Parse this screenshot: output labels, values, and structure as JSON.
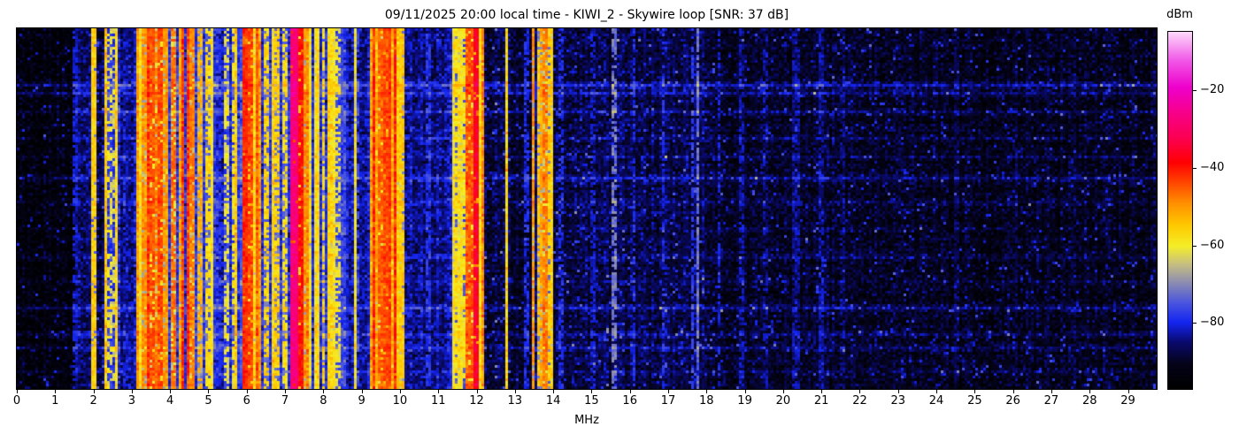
{
  "title": "09/11/2025 20:00 local time - KIWI_2 - Skywire loop [SNR: 37 dB]",
  "station": {
    "date": "09/11/2025",
    "time": "20:00 local time",
    "receiver": "KIWI_2",
    "antenna": "Skywire loop",
    "snr": "37 dB"
  },
  "colors": {
    "background": "#ffffff",
    "text": "#000000",
    "axes": "#000000"
  },
  "chart_data": {
    "type": "heatmap",
    "subtype": "radio-spectrum-waterfall",
    "title": "09/11/2025 20:00 local time - KIWI_2 - Skywire loop [SNR: 37 dB]",
    "xlabel": "MHz",
    "x_range": [
      0,
      29.75
    ],
    "x_ticks": [
      0,
      1,
      2,
      3,
      4,
      5,
      6,
      7,
      8,
      9,
      10,
      11,
      12,
      13,
      14,
      15,
      16,
      17,
      18,
      19,
      20,
      21,
      22,
      23,
      24,
      25,
      26,
      27,
      28,
      29
    ],
    "y_axis": {
      "meaning": "time (rows, no tick labels shown)",
      "ticks": []
    },
    "grid": false,
    "colorbar": {
      "label": "dBm",
      "vmin": -97,
      "vmax": -5,
      "ticks": [
        {
          "value": -20,
          "label": "−20"
        },
        {
          "value": -40,
          "label": "−40"
        },
        {
          "value": -60,
          "label": "−60"
        },
        {
          "value": -80,
          "label": "−80"
        }
      ]
    },
    "colormap_stops": [
      [
        0.0,
        "#000000"
      ],
      [
        0.07,
        "#05041a"
      ],
      [
        0.13,
        "#0a0a6e"
      ],
      [
        0.185,
        "#1425f0"
      ],
      [
        0.24,
        "#4a55e0"
      ],
      [
        0.3,
        "#9090b0"
      ],
      [
        0.35,
        "#c8c080"
      ],
      [
        0.4,
        "#f5ef28"
      ],
      [
        0.46,
        "#ffc800"
      ],
      [
        0.52,
        "#ff9000"
      ],
      [
        0.58,
        "#ff4400"
      ],
      [
        0.635,
        "#ff0004"
      ],
      [
        0.7,
        "#fc0050"
      ],
      [
        0.78,
        "#f70090"
      ],
      [
        0.845,
        "#ee00cc"
      ],
      [
        0.92,
        "#f158e8"
      ],
      [
        1.0,
        "#fed9fb"
      ]
    ],
    "noise_floor_segments": [
      [
        0.0,
        1.5,
        -94,
        0,
        0,
        0
      ],
      [
        1.5,
        1.95,
        -85,
        0.02,
        0,
        0
      ],
      [
        1.95,
        2.3,
        -88,
        0,
        0,
        0
      ],
      [
        2.3,
        2.7,
        -82,
        0.18,
        0.03,
        0
      ],
      [
        2.7,
        3.1,
        -84,
        0.08,
        0,
        0
      ],
      [
        3.1,
        5.1,
        -78,
        0.3,
        0.16,
        0.1
      ],
      [
        5.1,
        5.8,
        -80,
        0.22,
        0.06,
        0.02
      ],
      [
        5.8,
        6.25,
        -76,
        0.25,
        0.2,
        0.18
      ],
      [
        6.25,
        7.1,
        -78,
        0.28,
        0.12,
        0.06
      ],
      [
        7.1,
        7.45,
        -74,
        0.2,
        0.2,
        0.2
      ],
      [
        7.45,
        8.55,
        -78,
        0.3,
        0.1,
        0.03
      ],
      [
        8.55,
        9.2,
        -83,
        0.1,
        0.02,
        0
      ],
      [
        9.2,
        10.05,
        -72,
        0.3,
        0.3,
        0.12
      ],
      [
        10.05,
        11.3,
        -84,
        0.04,
        0.01,
        0
      ],
      [
        11.3,
        12.15,
        -80,
        0.22,
        0.08,
        0.05
      ],
      [
        12.15,
        13.4,
        -89,
        0.02,
        0,
        0
      ],
      [
        13.4,
        14.0,
        -84,
        0.12,
        0.04,
        0.04
      ],
      [
        14.0,
        18.0,
        -88,
        0.01,
        0,
        0
      ],
      [
        18.0,
        22.0,
        -90,
        0,
        0,
        0
      ],
      [
        22.0,
        29.75,
        -91,
        0,
        0,
        0
      ]
    ],
    "signal_lines": [
      [
        1.5,
        -82,
        0.05,
        0.3
      ],
      [
        2.0,
        -56,
        0.06,
        0.05
      ],
      [
        2.42,
        -62,
        0.05,
        0.5
      ],
      [
        2.55,
        -64,
        0.05,
        0.5
      ],
      [
        3.33,
        -50,
        0.06,
        0.2
      ],
      [
        3.5,
        -45,
        0.08,
        0.15
      ],
      [
        3.62,
        -48,
        0.06,
        0.2
      ],
      [
        3.75,
        -44,
        0.07,
        0.15
      ],
      [
        3.88,
        -50,
        0.06,
        0.2
      ],
      [
        4.05,
        -47,
        0.07,
        0.2
      ],
      [
        4.3,
        -52,
        0.06,
        0.25
      ],
      [
        4.55,
        -48,
        0.06,
        0.2
      ],
      [
        4.8,
        -53,
        0.06,
        0.25
      ],
      [
        5.0,
        -58,
        0.05,
        0.3
      ],
      [
        5.45,
        -62,
        0.05,
        0.4
      ],
      [
        5.65,
        -60,
        0.05,
        0.35
      ],
      [
        5.95,
        -42,
        0.1,
        0.1
      ],
      [
        6.07,
        -44,
        0.06,
        0.12
      ],
      [
        6.5,
        -57,
        0.05,
        0.3
      ],
      [
        6.8,
        -56,
        0.05,
        0.3
      ],
      [
        7.0,
        -58,
        0.05,
        0.3
      ],
      [
        7.25,
        -28,
        0.16,
        0.02
      ],
      [
        7.38,
        -40,
        0.05,
        0.1
      ],
      [
        7.45,
        -50,
        0.05,
        0.2
      ],
      [
        7.8,
        -59,
        0.05,
        0.35
      ],
      [
        8.0,
        -57,
        0.05,
        0.3
      ],
      [
        8.35,
        -61,
        0.05,
        0.4
      ],
      [
        8.9,
        -77,
        0.05,
        0.4
      ],
      [
        9.35,
        -52,
        0.06,
        0.15
      ],
      [
        9.5,
        -46,
        0.06,
        0.1
      ],
      [
        9.6,
        -44,
        0.06,
        0.1
      ],
      [
        9.72,
        -44,
        0.06,
        0.1
      ],
      [
        9.85,
        -52,
        0.06,
        0.15
      ],
      [
        10.0,
        -55,
        0.08,
        0.15
      ],
      [
        10.7,
        -79,
        0.05,
        0.4
      ],
      [
        11.45,
        -58,
        0.05,
        0.25
      ],
      [
        11.62,
        -60,
        0.05,
        0.3
      ],
      [
        11.85,
        -45,
        0.06,
        0.12
      ],
      [
        11.97,
        -35,
        0.06,
        0.05
      ],
      [
        12.1,
        -70,
        0.04,
        0.3
      ],
      [
        13.3,
        -80,
        0.04,
        0.4
      ],
      [
        13.46,
        -50,
        0.05,
        0.2
      ],
      [
        13.6,
        -55,
        0.05,
        0.25
      ],
      [
        13.7,
        -52,
        0.05,
        0.2
      ],
      [
        13.78,
        -48,
        0.05,
        0.15
      ],
      [
        13.93,
        -56,
        0.05,
        0.25
      ],
      [
        14.2,
        -80,
        0.04,
        0.4
      ],
      [
        15.0,
        -82,
        0.04,
        0.4
      ],
      [
        15.55,
        -72,
        0.05,
        0.3
      ],
      [
        16.1,
        -80,
        0.04,
        0.4
      ],
      [
        16.85,
        -80,
        0.04,
        0.4
      ],
      [
        17.6,
        -78,
        0.04,
        0.35
      ],
      [
        17.75,
        -73,
        0.06,
        0.15
      ],
      [
        18.3,
        -82,
        0.04,
        0.4
      ],
      [
        18.9,
        -83,
        0.04,
        0.4
      ],
      [
        19.5,
        -84,
        0.04,
        0.45
      ],
      [
        20.3,
        -84,
        0.12,
        0.3
      ],
      [
        20.95,
        -83,
        0.05,
        0.4
      ],
      [
        21.5,
        -85,
        0.04,
        0.5
      ],
      [
        23.0,
        -88,
        0.04,
        0.5
      ],
      [
        24.5,
        -88,
        0.04,
        0.5
      ],
      [
        26.0,
        -89,
        0.04,
        0.5
      ],
      [
        27.5,
        -89,
        0.04,
        0.5
      ]
    ],
    "broadband_streak_rows": [
      [
        0.155,
        9
      ],
      [
        0.175,
        6
      ],
      [
        0.23,
        5
      ],
      [
        0.3,
        3
      ],
      [
        0.355,
        3
      ],
      [
        0.41,
        6
      ],
      [
        0.48,
        4
      ],
      [
        0.555,
        3
      ],
      [
        0.63,
        4
      ],
      [
        0.7,
        3
      ],
      [
        0.77,
        6
      ],
      [
        0.845,
        4
      ],
      [
        0.885,
        5
      ],
      [
        0.95,
        3
      ]
    ]
  }
}
